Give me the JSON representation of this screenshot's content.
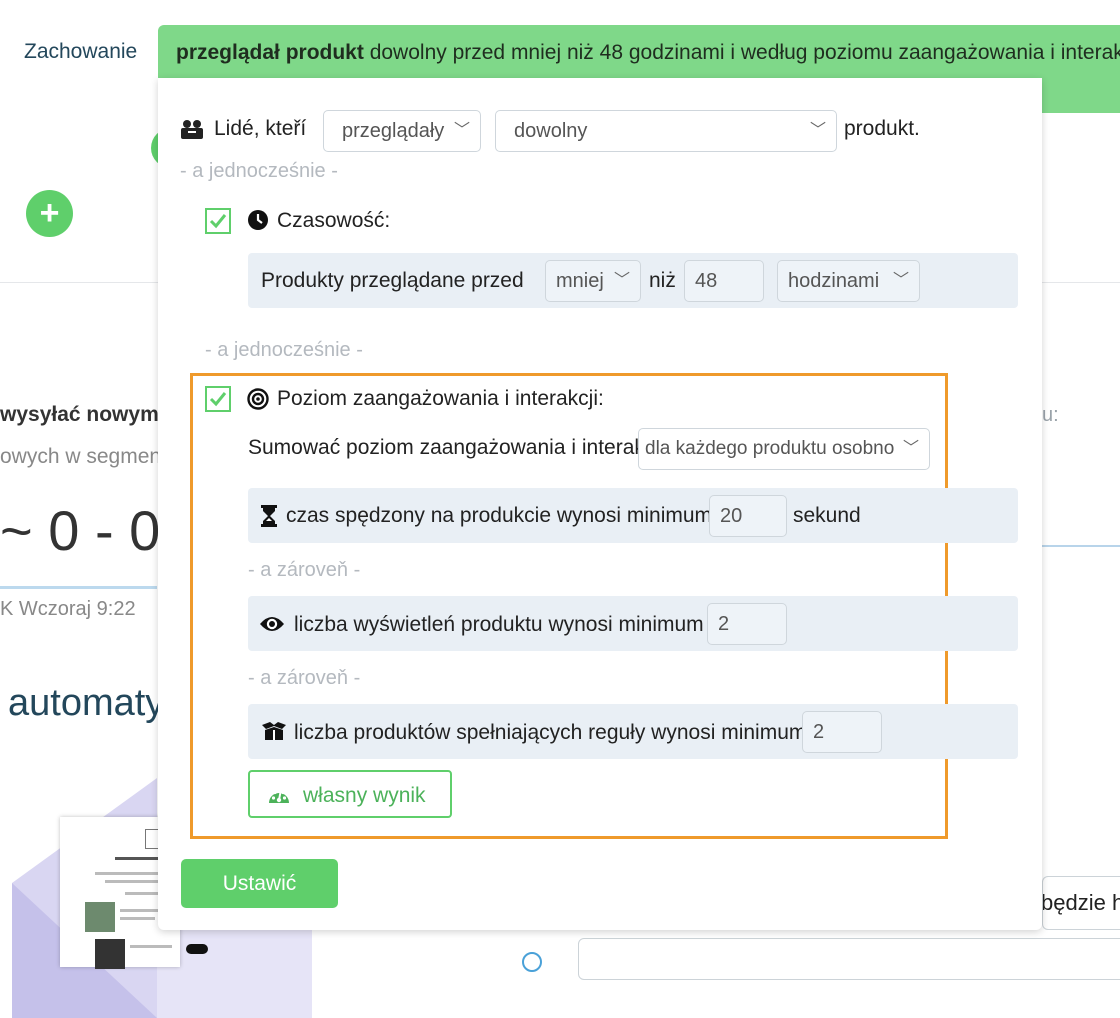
{
  "background": {
    "tab_label": "Zachowanie",
    "fab_symbol": "+",
    "text_bold": "wysyłać nowym",
    "text_muted": "owych w segmen",
    "score_text": "~ 0 - 0",
    "time_text": "K Wczoraj 9:22",
    "heading": "automaty",
    "right_label": "u:",
    "right_input_text": "będzie h"
  },
  "header": {
    "summary_bold": "przeglądał produkt",
    "summary_rest": " dowolny przed mniej niż 48 godzinami i według poziomu zaangażowania i interakcji dla"
  },
  "people_row": {
    "label": "Lidé, kteří",
    "action_select": "przeglądały",
    "product_select": "dowolny",
    "suffix": "produkt."
  },
  "and_simultaneously_1": "- a jednocześnie -",
  "time_section": {
    "checked": true,
    "title": "Czasowość:",
    "row_label": "Produkty przeglądane przed",
    "comparator": "mniej",
    "than_label": "niż",
    "amount": "48",
    "unit": "hodzinami"
  },
  "and_simultaneously_2": "- a jednocześnie -",
  "engagement_section": {
    "checked": true,
    "title": "Poziom zaangażowania i interakcji:",
    "sum_label": "Sumować poziom zaangażowania i interakcji",
    "sum_select": "dla każdego produktu osobno",
    "time_rule": {
      "label": "czas spędzony na produkcie wynosi minimum",
      "value": "20",
      "suffix": "sekund"
    },
    "and_also_1": "- a zároveň -",
    "views_rule": {
      "label": "liczba wyświetleń produktu wynosi minimum",
      "value": "2"
    },
    "and_also_2": "- a zároveň -",
    "products_rule": {
      "label": "liczba produktów spełniających reguły wynosi minimum",
      "value": "2"
    },
    "custom_score_label": "własny wynik"
  },
  "submit_label": "Ustawić",
  "colors": {
    "accent_green": "#5fcf6b",
    "header_green": "#7fd889",
    "highlight_orange": "#ef9a2b",
    "row_bg": "#e9eff5"
  }
}
